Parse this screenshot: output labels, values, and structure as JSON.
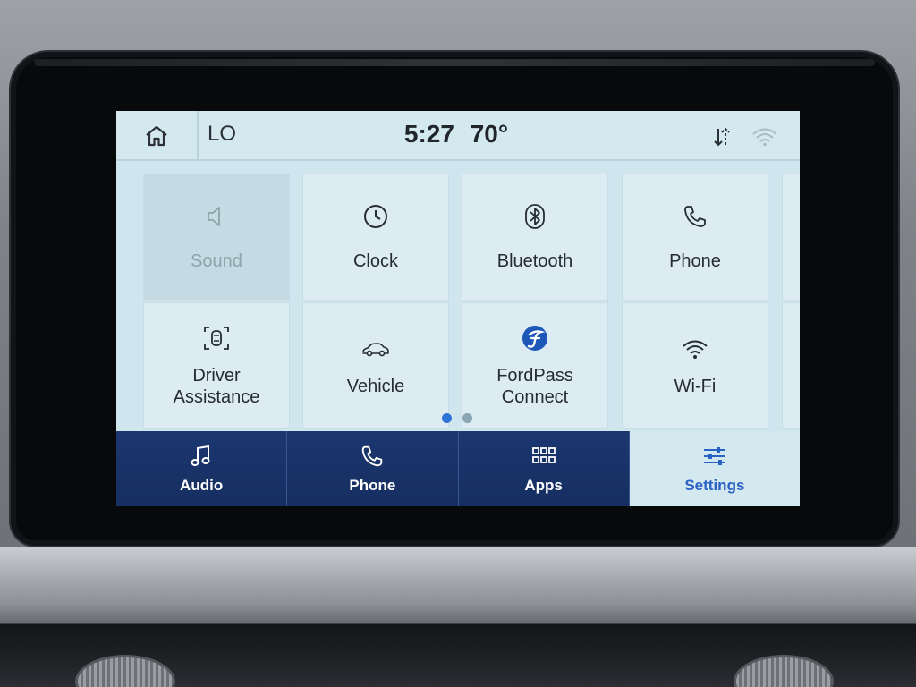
{
  "status_bar": {
    "climate_label": "LO",
    "time": "5:27",
    "temperature": "70°"
  },
  "settings_tiles": [
    {
      "label": "Sound",
      "icon": "speaker-icon",
      "disabled": true
    },
    {
      "label": "Clock",
      "icon": "clock-icon"
    },
    {
      "label": "Bluetooth",
      "icon": "bluetooth-icon"
    },
    {
      "label": "Phone",
      "icon": "phone-icon"
    },
    {
      "label": "Driver Assistance",
      "icon": "driver-assist-icon"
    },
    {
      "label": "Vehicle",
      "icon": "car-icon"
    },
    {
      "label": "FordPass Connect",
      "icon": "fordpass-icon"
    },
    {
      "label": "Wi-Fi",
      "icon": "wifi-icon"
    }
  ],
  "pagination": {
    "pages": 2,
    "current": 1
  },
  "nav": [
    {
      "label": "Audio",
      "icon": "music-note-icon"
    },
    {
      "label": "Phone",
      "icon": "phone-icon"
    },
    {
      "label": "Apps",
      "icon": "apps-grid-icon"
    },
    {
      "label": "Settings",
      "icon": "sliders-icon",
      "active": true
    }
  ],
  "colors": {
    "nav_background": "#1c3770",
    "active_accent": "#2a62c4",
    "screen_background": "#cfe6ee"
  }
}
